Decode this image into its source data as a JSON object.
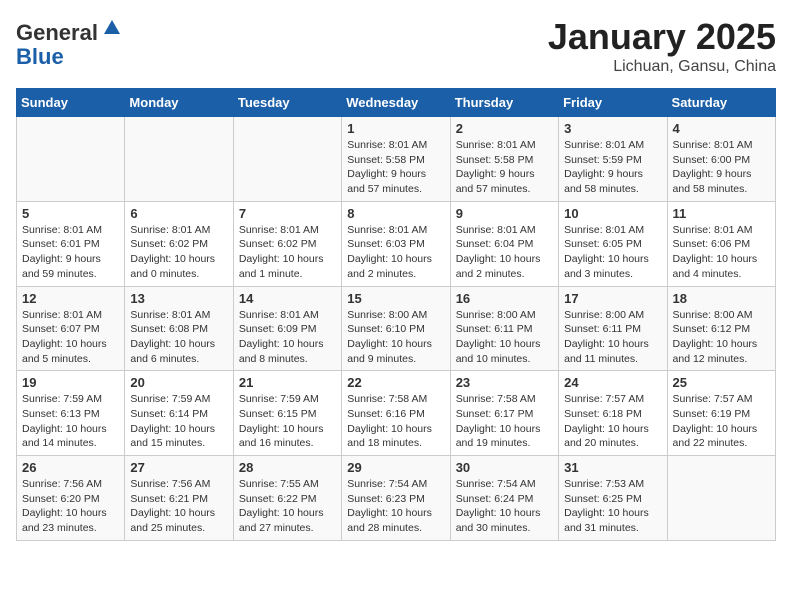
{
  "header": {
    "logo_general": "General",
    "logo_blue": "Blue",
    "month_title": "January 2025",
    "location": "Lichuan, Gansu, China"
  },
  "weekdays": [
    "Sunday",
    "Monday",
    "Tuesday",
    "Wednesday",
    "Thursday",
    "Friday",
    "Saturday"
  ],
  "weeks": [
    [
      {
        "day": null
      },
      {
        "day": null
      },
      {
        "day": null
      },
      {
        "day": "1",
        "sunrise": "Sunrise: 8:01 AM",
        "sunset": "Sunset: 5:58 PM",
        "daylight": "Daylight: 9 hours and 57 minutes."
      },
      {
        "day": "2",
        "sunrise": "Sunrise: 8:01 AM",
        "sunset": "Sunset: 5:58 PM",
        "daylight": "Daylight: 9 hours and 57 minutes."
      },
      {
        "day": "3",
        "sunrise": "Sunrise: 8:01 AM",
        "sunset": "Sunset: 5:59 PM",
        "daylight": "Daylight: 9 hours and 58 minutes."
      },
      {
        "day": "4",
        "sunrise": "Sunrise: 8:01 AM",
        "sunset": "Sunset: 6:00 PM",
        "daylight": "Daylight: 9 hours and 58 minutes."
      }
    ],
    [
      {
        "day": "5",
        "sunrise": "Sunrise: 8:01 AM",
        "sunset": "Sunset: 6:01 PM",
        "daylight": "Daylight: 9 hours and 59 minutes."
      },
      {
        "day": "6",
        "sunrise": "Sunrise: 8:01 AM",
        "sunset": "Sunset: 6:02 PM",
        "daylight": "Daylight: 10 hours and 0 minutes."
      },
      {
        "day": "7",
        "sunrise": "Sunrise: 8:01 AM",
        "sunset": "Sunset: 6:02 PM",
        "daylight": "Daylight: 10 hours and 1 minute."
      },
      {
        "day": "8",
        "sunrise": "Sunrise: 8:01 AM",
        "sunset": "Sunset: 6:03 PM",
        "daylight": "Daylight: 10 hours and 2 minutes."
      },
      {
        "day": "9",
        "sunrise": "Sunrise: 8:01 AM",
        "sunset": "Sunset: 6:04 PM",
        "daylight": "Daylight: 10 hours and 2 minutes."
      },
      {
        "day": "10",
        "sunrise": "Sunrise: 8:01 AM",
        "sunset": "Sunset: 6:05 PM",
        "daylight": "Daylight: 10 hours and 3 minutes."
      },
      {
        "day": "11",
        "sunrise": "Sunrise: 8:01 AM",
        "sunset": "Sunset: 6:06 PM",
        "daylight": "Daylight: 10 hours and 4 minutes."
      }
    ],
    [
      {
        "day": "12",
        "sunrise": "Sunrise: 8:01 AM",
        "sunset": "Sunset: 6:07 PM",
        "daylight": "Daylight: 10 hours and 5 minutes."
      },
      {
        "day": "13",
        "sunrise": "Sunrise: 8:01 AM",
        "sunset": "Sunset: 6:08 PM",
        "daylight": "Daylight: 10 hours and 6 minutes."
      },
      {
        "day": "14",
        "sunrise": "Sunrise: 8:01 AM",
        "sunset": "Sunset: 6:09 PM",
        "daylight": "Daylight: 10 hours and 8 minutes."
      },
      {
        "day": "15",
        "sunrise": "Sunrise: 8:00 AM",
        "sunset": "Sunset: 6:10 PM",
        "daylight": "Daylight: 10 hours and 9 minutes."
      },
      {
        "day": "16",
        "sunrise": "Sunrise: 8:00 AM",
        "sunset": "Sunset: 6:11 PM",
        "daylight": "Daylight: 10 hours and 10 minutes."
      },
      {
        "day": "17",
        "sunrise": "Sunrise: 8:00 AM",
        "sunset": "Sunset: 6:11 PM",
        "daylight": "Daylight: 10 hours and 11 minutes."
      },
      {
        "day": "18",
        "sunrise": "Sunrise: 8:00 AM",
        "sunset": "Sunset: 6:12 PM",
        "daylight": "Daylight: 10 hours and 12 minutes."
      }
    ],
    [
      {
        "day": "19",
        "sunrise": "Sunrise: 7:59 AM",
        "sunset": "Sunset: 6:13 PM",
        "daylight": "Daylight: 10 hours and 14 minutes."
      },
      {
        "day": "20",
        "sunrise": "Sunrise: 7:59 AM",
        "sunset": "Sunset: 6:14 PM",
        "daylight": "Daylight: 10 hours and 15 minutes."
      },
      {
        "day": "21",
        "sunrise": "Sunrise: 7:59 AM",
        "sunset": "Sunset: 6:15 PM",
        "daylight": "Daylight: 10 hours and 16 minutes."
      },
      {
        "day": "22",
        "sunrise": "Sunrise: 7:58 AM",
        "sunset": "Sunset: 6:16 PM",
        "daylight": "Daylight: 10 hours and 18 minutes."
      },
      {
        "day": "23",
        "sunrise": "Sunrise: 7:58 AM",
        "sunset": "Sunset: 6:17 PM",
        "daylight": "Daylight: 10 hours and 19 minutes."
      },
      {
        "day": "24",
        "sunrise": "Sunrise: 7:57 AM",
        "sunset": "Sunset: 6:18 PM",
        "daylight": "Daylight: 10 hours and 20 minutes."
      },
      {
        "day": "25",
        "sunrise": "Sunrise: 7:57 AM",
        "sunset": "Sunset: 6:19 PM",
        "daylight": "Daylight: 10 hours and 22 minutes."
      }
    ],
    [
      {
        "day": "26",
        "sunrise": "Sunrise: 7:56 AM",
        "sunset": "Sunset: 6:20 PM",
        "daylight": "Daylight: 10 hours and 23 minutes."
      },
      {
        "day": "27",
        "sunrise": "Sunrise: 7:56 AM",
        "sunset": "Sunset: 6:21 PM",
        "daylight": "Daylight: 10 hours and 25 minutes."
      },
      {
        "day": "28",
        "sunrise": "Sunrise: 7:55 AM",
        "sunset": "Sunset: 6:22 PM",
        "daylight": "Daylight: 10 hours and 27 minutes."
      },
      {
        "day": "29",
        "sunrise": "Sunrise: 7:54 AM",
        "sunset": "Sunset: 6:23 PM",
        "daylight": "Daylight: 10 hours and 28 minutes."
      },
      {
        "day": "30",
        "sunrise": "Sunrise: 7:54 AM",
        "sunset": "Sunset: 6:24 PM",
        "daylight": "Daylight: 10 hours and 30 minutes."
      },
      {
        "day": "31",
        "sunrise": "Sunrise: 7:53 AM",
        "sunset": "Sunset: 6:25 PM",
        "daylight": "Daylight: 10 hours and 31 minutes."
      },
      {
        "day": null
      }
    ]
  ]
}
